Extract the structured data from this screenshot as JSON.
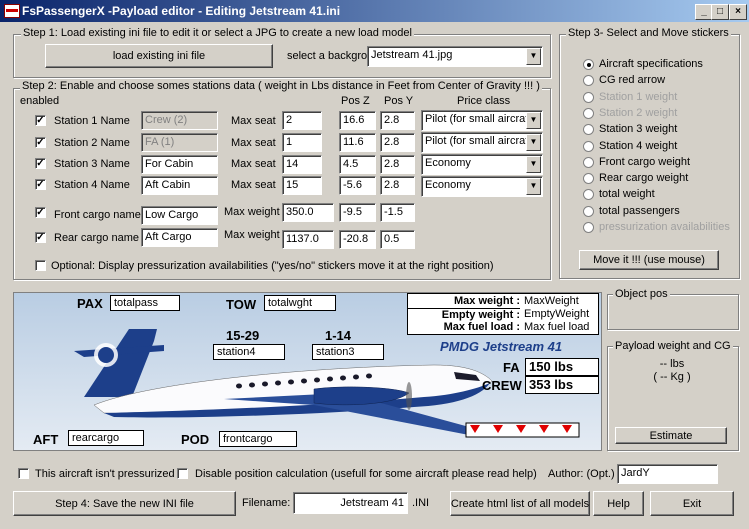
{
  "window": {
    "title": "FsPassengerX  -Payload editor -  Editing Jetstream 41.ini",
    "min": "_",
    "max": "□",
    "close": "×"
  },
  "step1": {
    "label": "Step 1:  Load existing ini file to edit it or select a JPG to create a new load model",
    "load_button": "load existing ini file",
    "bg_label": "select a background",
    "bg_value": "Jetstream 41.jpg"
  },
  "step2": {
    "label": "Step 2:  Enable and choose somes stations data ( weight in Lbs distance in Feet from Center of Gravity  !!! )",
    "enabled_label": "enabled",
    "headers": {
      "posz": "Pos Z",
      "posy": "Pos Y",
      "price": "Price class"
    },
    "stations": [
      {
        "label": "Station 1 Name",
        "name": "Crew (2)",
        "maxlabel": "Max seat",
        "max": "2",
        "z": "16.6",
        "y": "2.8",
        "price": "Pilot (for small aircraft)",
        "disabled": true
      },
      {
        "label": "Station 2 Name",
        "name": "FA (1)",
        "maxlabel": "Max seat",
        "max": "1",
        "z": "11.6",
        "y": "2.8",
        "price": "Pilot (for small aircraft)",
        "disabled": true
      },
      {
        "label": "Station 3 Name",
        "name": "For Cabin",
        "maxlabel": "Max seat",
        "max": "14",
        "z": "4.5",
        "y": "2.8",
        "price": "Economy",
        "disabled": false
      },
      {
        "label": "Station 4 Name",
        "name": "Aft Cabin",
        "maxlabel": "Max seat",
        "max": "15",
        "z": "-5.6",
        "y": "2.8",
        "price": "Economy",
        "disabled": false
      }
    ],
    "cargo": [
      {
        "label": "Front cargo name",
        "name": "Low Cargo",
        "maxlabel": "Max weight",
        "max": "350.0",
        "z": "-9.5",
        "y": "-1.5"
      },
      {
        "label": "Rear cargo name",
        "name": "Aft Cargo",
        "maxlabel": "Max weight",
        "max": "1137.0",
        "z": "-20.8",
        "y": "0.5"
      }
    ],
    "optional": "Optional: Display pressurization availabilities (\"yes/no\" stickers move it at the right position)"
  },
  "step3": {
    "label": "Step 3- Select and Move stickers",
    "options": [
      {
        "label": "Aircraft specifications",
        "selected": true,
        "disabled": false
      },
      {
        "label": "CG red arrow",
        "selected": false,
        "disabled": false
      },
      {
        "label": "Station 1 weight",
        "selected": false,
        "disabled": true
      },
      {
        "label": "Station 2 weight",
        "selected": false,
        "disabled": true
      },
      {
        "label": "Station 3 weight",
        "selected": false,
        "disabled": false
      },
      {
        "label": "Station 4 weight",
        "selected": false,
        "disabled": false
      },
      {
        "label": "Front cargo weight",
        "selected": false,
        "disabled": false
      },
      {
        "label": "Rear cargo weight",
        "selected": false,
        "disabled": false
      },
      {
        "label": "total weight",
        "selected": false,
        "disabled": false
      },
      {
        "label": "total passengers",
        "selected": false,
        "disabled": false
      },
      {
        "label": "pressurization availabilities",
        "selected": false,
        "disabled": true
      }
    ],
    "move_button": "Move it !!!   (use mouse)"
  },
  "canvas": {
    "pax_label": "PAX",
    "pax_value": "totalpass",
    "tow_label": "TOW",
    "tow_value": "totalwght",
    "maxw_label": "Max weight :",
    "maxw_value": "MaxWeight",
    "empty_label": "Empty weight :",
    "empty_value": "EmptyWeight",
    "fuel_label": "Max fuel load :",
    "fuel_value": "Max fuel load",
    "rows1_label": "15-29",
    "station4": "station4",
    "rows2_label": "1-14",
    "station3": "station3",
    "aircraft_name": "PMDG Jetstream 41",
    "fa_label": "FA",
    "fa_value": "150 lbs",
    "crew_label": "CREW",
    "crew_value": "353 lbs",
    "aft_label": "AFT",
    "aft_value": "rearcargo",
    "pod_label": "POD",
    "pod_value": "frontcargo"
  },
  "object_pos": {
    "label": "Object pos"
  },
  "payload": {
    "label": "Payload weight and CG",
    "lbs": "-- lbs",
    "kg": "( -- Kg )",
    "estimate_button": "Estimate"
  },
  "bottom": {
    "not_pressurized": "This aircraft isn't pressurized",
    "disable_calc": "Disable position calculation (usefull for some aircraft please read help)",
    "author_label": "Author: (Opt.)",
    "author_value": "JardY",
    "save_button": "Step 4:  Save the new INI file",
    "filename_label": "Filename:",
    "filename_value": "Jetstream 41",
    "ext": ".INI",
    "html_button": "Create html list of all models",
    "help_button": "Help",
    "exit_button": "Exit"
  },
  "colors": {
    "title_start": "#0a246a",
    "title_end": "#a6caf0",
    "livery_blue": "#1d3f8a",
    "sky": "#c9d9ea"
  }
}
